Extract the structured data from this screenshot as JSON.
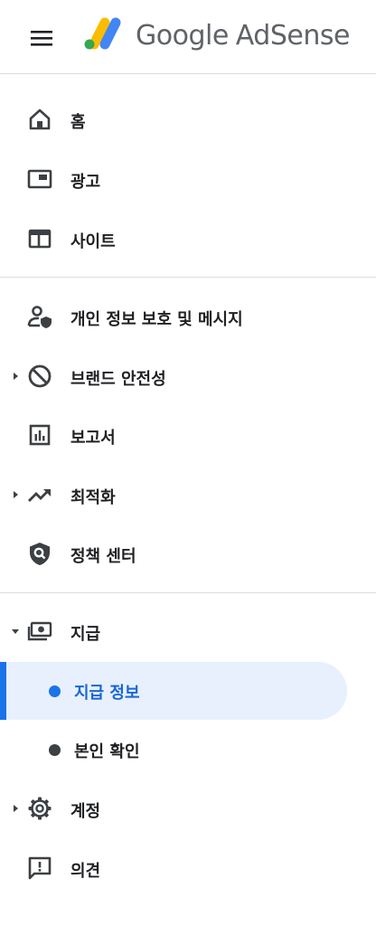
{
  "header": {
    "menu_icon": "hamburger-menu-icon",
    "brand_google": "Google",
    "brand_product": "AdSense",
    "logo_colors": {
      "yellow": "#fbbc04",
      "blue": "#4285f4",
      "green": "#34a853"
    }
  },
  "nav": {
    "home": {
      "label": "홈",
      "icon": "home-icon"
    },
    "ads": {
      "label": "광고",
      "icon": "ads-icon"
    },
    "sites": {
      "label": "사이트",
      "icon": "sites-icon"
    },
    "privacy": {
      "label": "개인 정보 보호 및 메시지",
      "icon": "privacy-messaging-icon"
    },
    "brand_safety": {
      "label": "브랜드 안전성",
      "icon": "block-icon",
      "expandable": true
    },
    "reports": {
      "label": "보고서",
      "icon": "bar-chart-icon"
    },
    "optimization": {
      "label": "최적화",
      "icon": "trending-up-icon",
      "expandable": true
    },
    "policy_center": {
      "label": "정책 센터",
      "icon": "policy-shield-icon"
    },
    "payments": {
      "label": "지급",
      "icon": "payments-icon",
      "expanded": true,
      "children": [
        {
          "label": "지급 정보",
          "active": true
        },
        {
          "label": "본인 확인",
          "active": false
        }
      ]
    },
    "account": {
      "label": "계정",
      "icon": "gear-icon",
      "expandable": true
    },
    "feedback": {
      "label": "의견",
      "icon": "feedback-icon"
    }
  },
  "colors": {
    "accent": "#1a73e8",
    "active_bg": "#e8f0fe",
    "icon": "#3c4043",
    "divider": "#dadce0"
  }
}
